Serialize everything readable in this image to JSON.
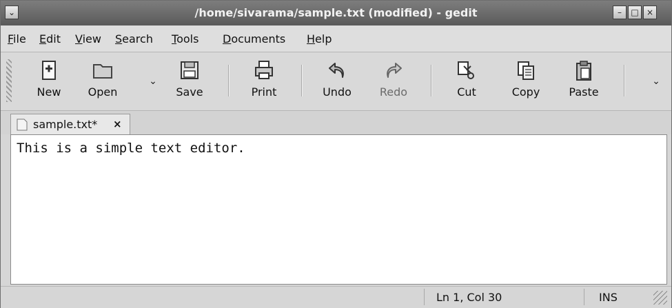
{
  "window": {
    "title": "/home/sivarama/sample.txt (modified) - gedit",
    "controls": {
      "menu": "⌄",
      "minimize": "–",
      "maximize": "□",
      "close": "×"
    }
  },
  "menubar": {
    "items": [
      {
        "first": "F",
        "rest": "ile"
      },
      {
        "first": "E",
        "rest": "dit"
      },
      {
        "first": "V",
        "rest": "iew"
      },
      {
        "first": "S",
        "rest": "earch"
      },
      {
        "first": "T",
        "rest": "ools"
      },
      {
        "first": "D",
        "rest": "ocuments"
      },
      {
        "first": "H",
        "rest": "elp"
      }
    ]
  },
  "toolbar": {
    "new_label": "New",
    "open_label": "Open",
    "save_label": "Save",
    "print_label": "Print",
    "undo_label": "Undo",
    "redo_label": "Redo",
    "cut_label": "Cut",
    "copy_label": "Copy",
    "paste_label": "Paste",
    "dropdown_glyph": "⌄"
  },
  "tabs": [
    {
      "label": "sample.txt*",
      "close": "×"
    }
  ],
  "editor": {
    "content": "This is a simple text editor."
  },
  "statusbar": {
    "position": "Ln 1, Col 30",
    "mode": "INS"
  },
  "icons": {
    "new": "new-document-icon",
    "open": "folder-icon",
    "save": "floppy-icon",
    "print": "printer-icon",
    "undo": "undo-icon",
    "redo": "redo-icon",
    "cut": "scissors-icon",
    "copy": "copy-icon",
    "paste": "clipboard-icon"
  }
}
